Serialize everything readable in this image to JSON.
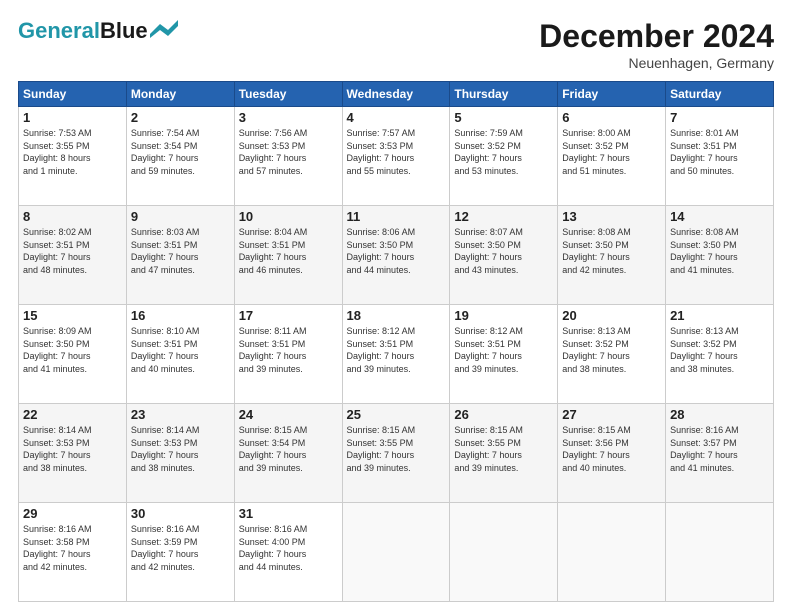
{
  "logo": {
    "line1": "General",
    "line2": "Blue"
  },
  "title": "December 2024",
  "location": "Neuenhagen, Germany",
  "days_header": [
    "Sunday",
    "Monday",
    "Tuesday",
    "Wednesday",
    "Thursday",
    "Friday",
    "Saturday"
  ],
  "weeks": [
    [
      {
        "day": "1",
        "info": "Sunrise: 7:53 AM\nSunset: 3:55 PM\nDaylight: 8 hours\nand 1 minute."
      },
      {
        "day": "2",
        "info": "Sunrise: 7:54 AM\nSunset: 3:54 PM\nDaylight: 7 hours\nand 59 minutes."
      },
      {
        "day": "3",
        "info": "Sunrise: 7:56 AM\nSunset: 3:53 PM\nDaylight: 7 hours\nand 57 minutes."
      },
      {
        "day": "4",
        "info": "Sunrise: 7:57 AM\nSunset: 3:53 PM\nDaylight: 7 hours\nand 55 minutes."
      },
      {
        "day": "5",
        "info": "Sunrise: 7:59 AM\nSunset: 3:52 PM\nDaylight: 7 hours\nand 53 minutes."
      },
      {
        "day": "6",
        "info": "Sunrise: 8:00 AM\nSunset: 3:52 PM\nDaylight: 7 hours\nand 51 minutes."
      },
      {
        "day": "7",
        "info": "Sunrise: 8:01 AM\nSunset: 3:51 PM\nDaylight: 7 hours\nand 50 minutes."
      }
    ],
    [
      {
        "day": "8",
        "info": "Sunrise: 8:02 AM\nSunset: 3:51 PM\nDaylight: 7 hours\nand 48 minutes."
      },
      {
        "day": "9",
        "info": "Sunrise: 8:03 AM\nSunset: 3:51 PM\nDaylight: 7 hours\nand 47 minutes."
      },
      {
        "day": "10",
        "info": "Sunrise: 8:04 AM\nSunset: 3:51 PM\nDaylight: 7 hours\nand 46 minutes."
      },
      {
        "day": "11",
        "info": "Sunrise: 8:06 AM\nSunset: 3:50 PM\nDaylight: 7 hours\nand 44 minutes."
      },
      {
        "day": "12",
        "info": "Sunrise: 8:07 AM\nSunset: 3:50 PM\nDaylight: 7 hours\nand 43 minutes."
      },
      {
        "day": "13",
        "info": "Sunrise: 8:08 AM\nSunset: 3:50 PM\nDaylight: 7 hours\nand 42 minutes."
      },
      {
        "day": "14",
        "info": "Sunrise: 8:08 AM\nSunset: 3:50 PM\nDaylight: 7 hours\nand 41 minutes."
      }
    ],
    [
      {
        "day": "15",
        "info": "Sunrise: 8:09 AM\nSunset: 3:50 PM\nDaylight: 7 hours\nand 41 minutes."
      },
      {
        "day": "16",
        "info": "Sunrise: 8:10 AM\nSunset: 3:51 PM\nDaylight: 7 hours\nand 40 minutes."
      },
      {
        "day": "17",
        "info": "Sunrise: 8:11 AM\nSunset: 3:51 PM\nDaylight: 7 hours\nand 39 minutes."
      },
      {
        "day": "18",
        "info": "Sunrise: 8:12 AM\nSunset: 3:51 PM\nDaylight: 7 hours\nand 39 minutes."
      },
      {
        "day": "19",
        "info": "Sunrise: 8:12 AM\nSunset: 3:51 PM\nDaylight: 7 hours\nand 39 minutes."
      },
      {
        "day": "20",
        "info": "Sunrise: 8:13 AM\nSunset: 3:52 PM\nDaylight: 7 hours\nand 38 minutes."
      },
      {
        "day": "21",
        "info": "Sunrise: 8:13 AM\nSunset: 3:52 PM\nDaylight: 7 hours\nand 38 minutes."
      }
    ],
    [
      {
        "day": "22",
        "info": "Sunrise: 8:14 AM\nSunset: 3:53 PM\nDaylight: 7 hours\nand 38 minutes."
      },
      {
        "day": "23",
        "info": "Sunrise: 8:14 AM\nSunset: 3:53 PM\nDaylight: 7 hours\nand 38 minutes."
      },
      {
        "day": "24",
        "info": "Sunrise: 8:15 AM\nSunset: 3:54 PM\nDaylight: 7 hours\nand 39 minutes."
      },
      {
        "day": "25",
        "info": "Sunrise: 8:15 AM\nSunset: 3:55 PM\nDaylight: 7 hours\nand 39 minutes."
      },
      {
        "day": "26",
        "info": "Sunrise: 8:15 AM\nSunset: 3:55 PM\nDaylight: 7 hours\nand 39 minutes."
      },
      {
        "day": "27",
        "info": "Sunrise: 8:15 AM\nSunset: 3:56 PM\nDaylight: 7 hours\nand 40 minutes."
      },
      {
        "day": "28",
        "info": "Sunrise: 8:16 AM\nSunset: 3:57 PM\nDaylight: 7 hours\nand 41 minutes."
      }
    ],
    [
      {
        "day": "29",
        "info": "Sunrise: 8:16 AM\nSunset: 3:58 PM\nDaylight: 7 hours\nand 42 minutes."
      },
      {
        "day": "30",
        "info": "Sunrise: 8:16 AM\nSunset: 3:59 PM\nDaylight: 7 hours\nand 42 minutes."
      },
      {
        "day": "31",
        "info": "Sunrise: 8:16 AM\nSunset: 4:00 PM\nDaylight: 7 hours\nand 44 minutes."
      },
      {
        "day": "",
        "info": ""
      },
      {
        "day": "",
        "info": ""
      },
      {
        "day": "",
        "info": ""
      },
      {
        "day": "",
        "info": ""
      }
    ]
  ]
}
